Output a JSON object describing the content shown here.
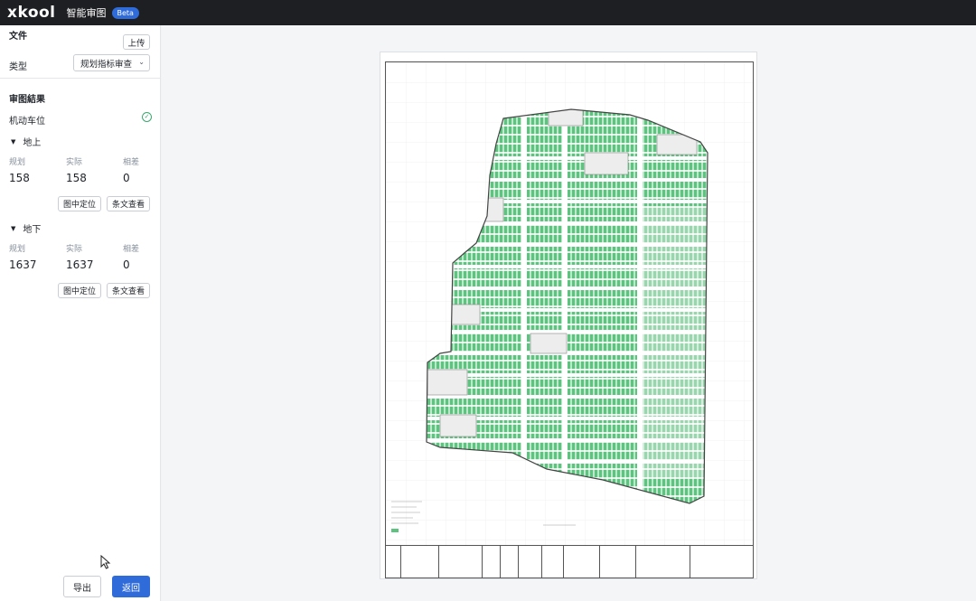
{
  "header": {
    "logo": "xkool",
    "app_title": "智能审图",
    "badge": "Beta"
  },
  "sidebar": {
    "file_label": "文件",
    "upload_label": "上传",
    "type_label": "类型",
    "type_value": "规划指标审查",
    "results_label": "审图結果",
    "category_label": "机动车位",
    "sections": [
      {
        "title": "地上",
        "headers": [
          "规划",
          "实际",
          "相差"
        ],
        "values": [
          "158",
          "158",
          "0"
        ],
        "locate_label": "图中定位",
        "clause_label": "条文查看"
      },
      {
        "title": "地下",
        "headers": [
          "规划",
          "实际",
          "相差"
        ],
        "values": [
          "1637",
          "1637",
          "0"
        ],
        "locate_label": "图中定位",
        "clause_label": "条文查看"
      }
    ],
    "export_label": "导出",
    "back_label": "返回"
  },
  "colors": {
    "primary": "#2f6bd9",
    "success": "#3aa76d",
    "parking": "#4cbf73"
  }
}
